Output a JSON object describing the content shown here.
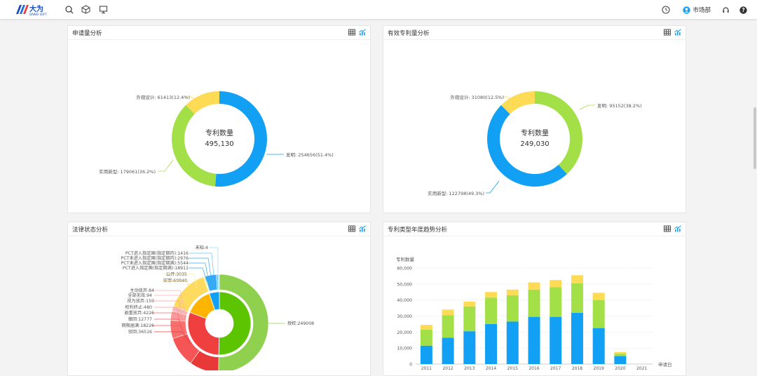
{
  "brand": {
    "name": "大为",
    "sub": "DAWEI SOFT"
  },
  "header": {
    "user": "市场部"
  },
  "icons": [
    "search-icon",
    "cube-icon",
    "monitor-icon",
    "clock-icon",
    "user-icon",
    "headset-icon",
    "help-icon",
    "table-icon",
    "chart-icon"
  ],
  "colors": {
    "blue": "#12a0f5",
    "green": "#a3e048",
    "yellow": "#fddb55",
    "red": "#ef3f3f"
  },
  "panels": {
    "p1": {
      "title": "申请量分析"
    },
    "p2": {
      "title": "有效专利量分析"
    },
    "p3": {
      "title": "法律状态分析"
    },
    "p4": {
      "title": "专利类型年度趋势分析"
    }
  },
  "donut1": {
    "center_title": "专利数量",
    "center_value": "495,130",
    "labels": {
      "invention": "发明: 254656(51.4%)",
      "utility": "实用新型: 179061(36.2%)",
      "design": "外观设计: 61413(12.4%)"
    },
    "values": [
      254656,
      179061,
      61413
    ]
  },
  "donut2": {
    "center_title": "专利数量",
    "center_value": "249,030",
    "labels": {
      "invention": "发明: 95152(38.2%)",
      "utility": "实用新型: 122798(49.3%)",
      "design": "外观设计: 31080(12.5%)"
    },
    "values": [
      95152,
      122798,
      31080
    ]
  },
  "legal": {
    "labels": [
      "未知:4",
      "PCT进入指定国(指定期内):1416",
      "PCT未进入指定国(指定期内):2976",
      "PCT未进入指定国(指定期满):5544",
      "PCT进入指定国(指定期满):18911",
      "公开:3035",
      "实审:69840",
      "主动放弃:84",
      "全部无效:94",
      "视为放弃:159",
      "权利终止:480",
      "避重放弃:4226",
      "撤回:12777",
      "期限届满:18226",
      "驳回:36516",
      "授权:249008"
    ]
  },
  "chart_data": {
    "type": "bar",
    "stacked": true,
    "ylabel": "专利数量",
    "xlabel": "申请日",
    "ylim": [
      0,
      60000
    ],
    "yticks": [
      "0",
      "10,000",
      "20,000",
      "30,000",
      "40,000",
      "50,000",
      "60,000"
    ],
    "categories": [
      "2011",
      "2012",
      "2013",
      "2014",
      "2015",
      "2016",
      "2017",
      "2018",
      "2019",
      "2020",
      "2021"
    ],
    "series": [
      {
        "values": [
          11500,
          16500,
          20500,
          25000,
          26500,
          29500,
          29500,
          32000,
          22500,
          5000,
          0
        ]
      },
      {
        "values": [
          10000,
          14000,
          15500,
          16500,
          16500,
          17000,
          18500,
          18500,
          17500,
          1500,
          0
        ]
      },
      {
        "values": [
          3000,
          3500,
          3000,
          3500,
          3500,
          4500,
          4500,
          5000,
          4500,
          1000,
          0
        ]
      }
    ],
    "grid": true
  }
}
